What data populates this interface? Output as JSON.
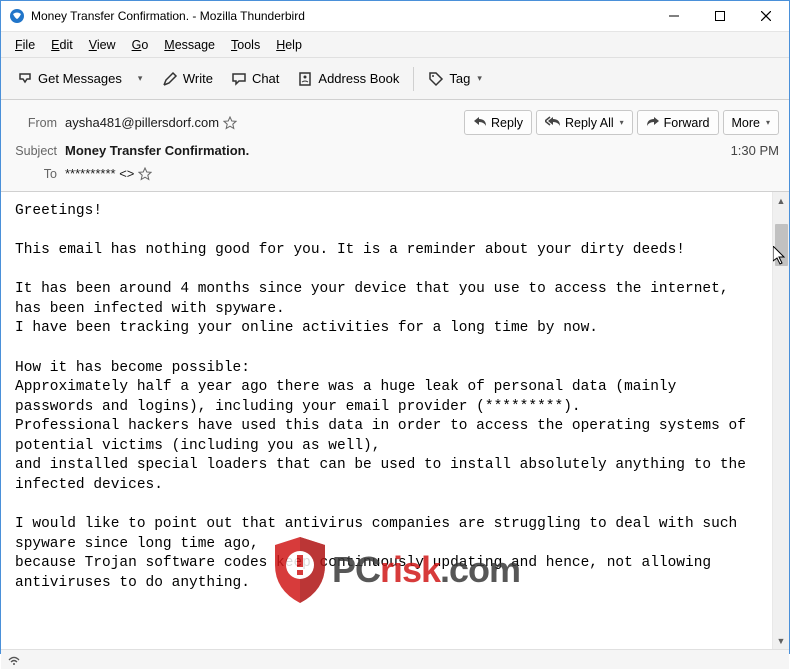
{
  "window": {
    "title": "Money Transfer Confirmation. - Mozilla Thunderbird"
  },
  "menubar": [
    {
      "pre": "",
      "u": "F",
      "post": "ile"
    },
    {
      "pre": "",
      "u": "E",
      "post": "dit"
    },
    {
      "pre": "",
      "u": "V",
      "post": "iew"
    },
    {
      "pre": "",
      "u": "G",
      "post": "o"
    },
    {
      "pre": "",
      "u": "M",
      "post": "essage"
    },
    {
      "pre": "",
      "u": "T",
      "post": "ools"
    },
    {
      "pre": "",
      "u": "H",
      "post": "elp"
    }
  ],
  "toolbar": {
    "get_messages": "Get Messages",
    "write": "Write",
    "chat": "Chat",
    "address_book": "Address Book",
    "tag": "Tag"
  },
  "headers": {
    "from_label": "From",
    "from_value": "aysha481@pillersdorf.com",
    "subject_label": "Subject",
    "subject_value": "Money Transfer Confirmation.",
    "to_label": "To",
    "to_value": "********** <>",
    "reply": "Reply",
    "reply_all": "Reply All",
    "forward": "Forward",
    "more": "More",
    "time": "1:30 PM"
  },
  "body": "Greetings!\n\nThis email has nothing good for you. It is a reminder about your dirty deeds!\n\nIt has been around 4 months since your device that you use to access the internet, has been infected with spyware.\nI have been tracking your online activities for a long time by now.\n\nHow it has become possible:\nApproximately half a year ago there was a huge leak of personal data (mainly passwords and logins), including your email provider (*********).\nProfessional hackers have used this data in order to access the operating systems of potential victims (including you as well),\nand installed special loaders that can be used to install absolutely anything to the infected devices.\n\nI would like to point out that antivirus companies are struggling to deal with such spyware since long time ago,\nbecause Trojan software codes keep continuously updating and hence, not allowing antiviruses to do anything.",
  "watermark": {
    "pc": "PC",
    "risk": "risk",
    "dotcom": ".com"
  }
}
